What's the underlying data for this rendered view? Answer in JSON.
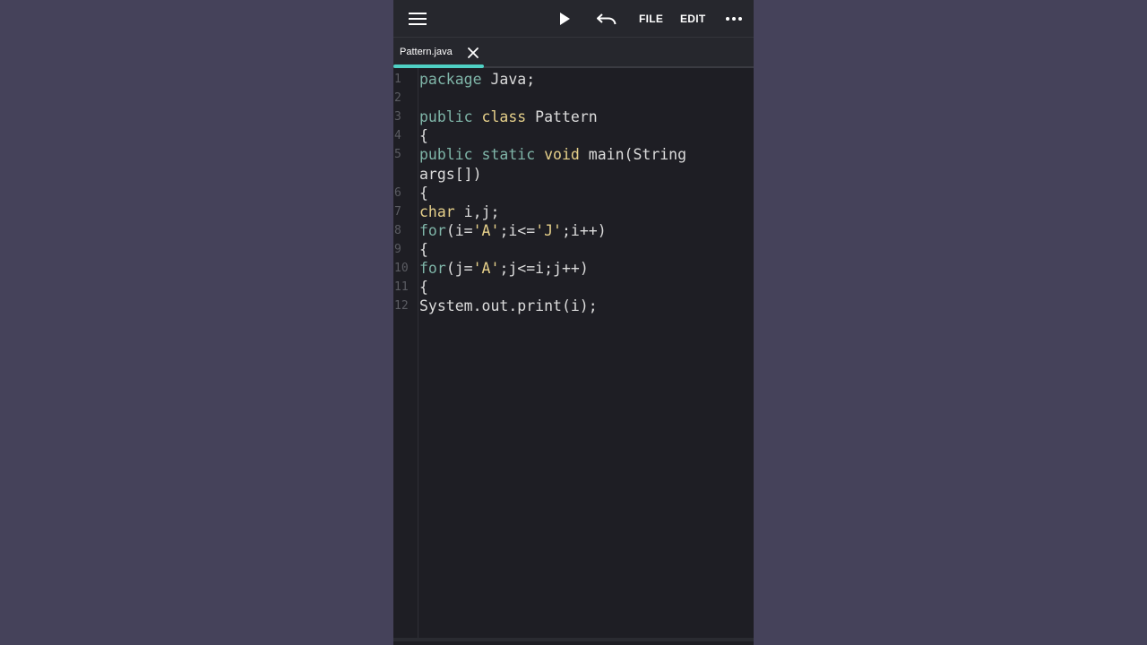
{
  "toolbar": {
    "menu_icon": "hamburger-menu-icon",
    "run_icon": "play-icon",
    "undo_icon": "undo-icon",
    "file_label": "FILE",
    "edit_label": "EDIT",
    "more_icon": "more-horizontal-icon"
  },
  "tabs": [
    {
      "label": "Pattern.java",
      "active": true,
      "close_icon": "close-icon"
    }
  ],
  "colors": {
    "accent": "#4fd1c5",
    "keyword": "#7fb5a8",
    "type": "#e6d08a",
    "string": "#e6d08a",
    "plain": "#dcdcdc",
    "line_number": "#5b5c63",
    "editor_bg": "#1e1e24",
    "outer_bg": "#45425a"
  },
  "editor": {
    "lines": [
      {
        "num": "1",
        "tokens": [
          {
            "t": "kw",
            "s": "package"
          },
          {
            "t": "pl",
            "s": " Java;"
          }
        ]
      },
      {
        "num": "2",
        "tokens": []
      },
      {
        "num": "3",
        "tokens": [
          {
            "t": "kw",
            "s": "public"
          },
          {
            "t": "pl",
            "s": " "
          },
          {
            "t": "ty",
            "s": "class"
          },
          {
            "t": "pl",
            "s": " Pattern"
          }
        ]
      },
      {
        "num": "4",
        "tokens": [
          {
            "t": "pl",
            "s": "{"
          }
        ]
      },
      {
        "num": "5",
        "tokens": [
          {
            "t": "kw",
            "s": "public"
          },
          {
            "t": "pl",
            "s": " "
          },
          {
            "t": "kw",
            "s": "static"
          },
          {
            "t": "pl",
            "s": " "
          },
          {
            "t": "ty",
            "s": "void"
          },
          {
            "t": "pl",
            "s": " main(String"
          }
        ]
      },
      {
        "num": "",
        "tokens": [
          {
            "t": "pl",
            "s": "args[])"
          }
        ]
      },
      {
        "num": "6",
        "tokens": [
          {
            "t": "pl",
            "s": "{"
          }
        ]
      },
      {
        "num": "7",
        "tokens": [
          {
            "t": "ty",
            "s": "char"
          },
          {
            "t": "pl",
            "s": " i,j;"
          }
        ]
      },
      {
        "num": "8",
        "tokens": [
          {
            "t": "kw",
            "s": "for"
          },
          {
            "t": "pl",
            "s": "(i="
          },
          {
            "t": "str",
            "s": "'A'"
          },
          {
            "t": "pl",
            "s": ";i<="
          },
          {
            "t": "str",
            "s": "'J'"
          },
          {
            "t": "pl",
            "s": ";i++)"
          }
        ]
      },
      {
        "num": "9",
        "tokens": [
          {
            "t": "pl",
            "s": "{"
          }
        ]
      },
      {
        "num": "10",
        "tokens": [
          {
            "t": "kw",
            "s": "for"
          },
          {
            "t": "pl",
            "s": "(j="
          },
          {
            "t": "str",
            "s": "'A'"
          },
          {
            "t": "pl",
            "s": ";j<=i;j++)"
          }
        ]
      },
      {
        "num": "11",
        "tokens": [
          {
            "t": "pl",
            "s": "{"
          }
        ]
      },
      {
        "num": "12",
        "tokens": [
          {
            "t": "pl",
            "s": "System.out.print(i);"
          }
        ]
      }
    ]
  }
}
